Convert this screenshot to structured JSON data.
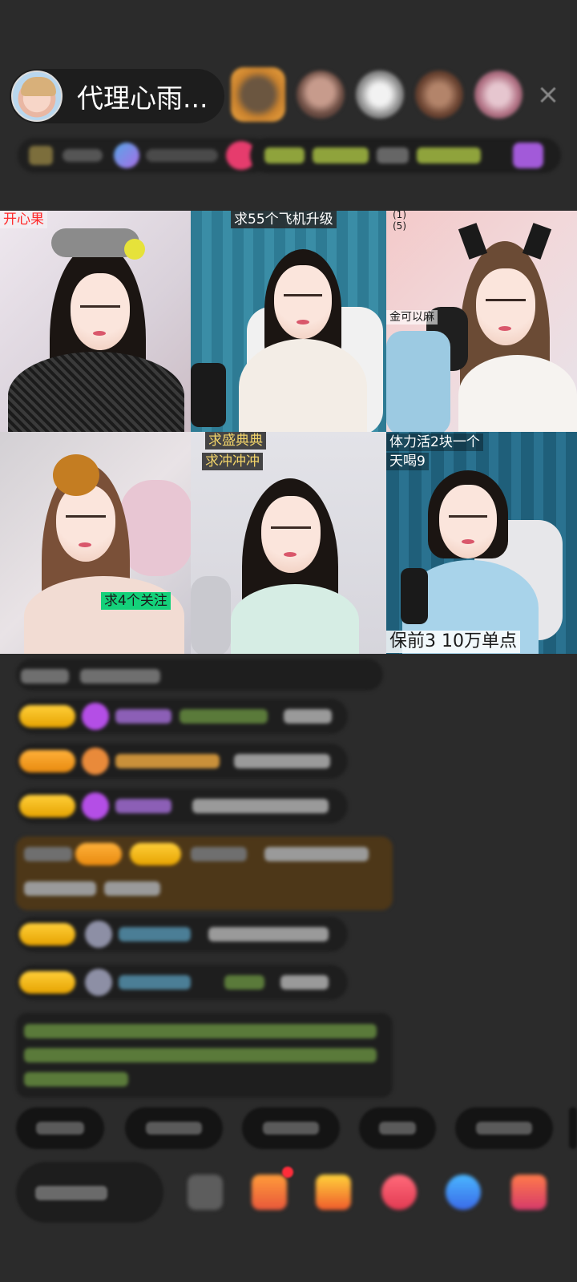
{
  "header": {
    "host_name": "代理心雨...",
    "close_label": "×"
  },
  "grid": {
    "tiles": [
      {
        "labels": [
          {
            "text": "开心果"
          }
        ]
      },
      {
        "labels": [
          {
            "text": "求55个飞机升级"
          }
        ]
      },
      {
        "labels": [
          {
            "text": "(1)"
          },
          {
            "text": "(5)"
          },
          {
            "text": "金可以麻"
          }
        ]
      },
      {
        "labels": [
          {
            "text": "求4个关注"
          }
        ]
      },
      {
        "labels": [
          {
            "text": "求盛典典"
          },
          {
            "text": "求冲冲冲"
          }
        ]
      },
      {
        "labels": [
          {
            "text": "体力活2块一个"
          },
          {
            "text": "天喝9"
          },
          {
            "text": "保前3  10万单点"
          }
        ]
      }
    ]
  },
  "colors": {
    "background": "#2b2b2b",
    "badge_gold": "#ffc21a",
    "gift_banner": "#4d3718",
    "tile_label_green": "#14d17a"
  }
}
